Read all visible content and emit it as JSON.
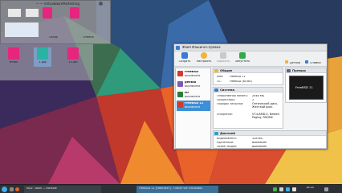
{
  "file_dialog": {
    "title": "~ — VirtualBoxVMs/testing",
    "buttons": [
      "Обзор",
      "Отмена"
    ],
    "files": [
      {
        "label": "fff.avi",
        "color": "#e6257e"
      },
      {
        "label": "1.jpg",
        "color": "#29b3a3"
      },
      {
        "label": "11.avi",
        "color": "#e6257e"
      }
    ]
  },
  "vbox": {
    "menu": [
      "Файл",
      "Машина",
      "Справка"
    ],
    "toolbar": [
      {
        "label": "Создать",
        "icon": "new-icon",
        "color": "#3b7ad6"
      },
      {
        "label": "Настроить",
        "icon": "settings-icon",
        "color": "#f0b43a"
      },
      {
        "label": "Сбросить",
        "icon": "discard-icon",
        "color": "#c9c9c9"
      },
      {
        "label": "Запустить",
        "icon": "start-icon",
        "color": "#33a94a"
      }
    ],
    "toolbar_right": [
      "Детали",
      "Снимки"
    ],
    "vm_list": [
      {
        "name": "FreeBSD",
        "state": "Выключена",
        "color": "#d33a2c"
      },
      {
        "name": "gentoo",
        "state": "Выключена",
        "color": "#7b5ab8"
      },
      {
        "name": "Mi",
        "state": "Выключена",
        "color": "#2f7a3a"
      },
      {
        "name": "FreeBSD 11",
        "state": "Выключена",
        "color": "#d33a2c",
        "selected": true
      }
    ],
    "general": {
      "title": "Общие",
      "rows": [
        {
          "k": "Имя:",
          "v": "FreeBSD 11"
        },
        {
          "k": "ОС:",
          "v": "FreeBSD (64 bit)"
        }
      ]
    },
    "preview": {
      "title": "Превью",
      "screen_text": "FreeBSD 11"
    },
    "system": {
      "title": "Система",
      "rows": [
        {
          "k": "Оперативная память:",
          "v": "2048 МБ"
        },
        {
          "k": "Процессоры:",
          "v": "2"
        },
        {
          "k": "Порядок загрузки:",
          "v": "Оптический диск, Жесткий диск"
        },
        {
          "k": "Ускорение:",
          "v": "VT-x/AMD-V, Nested Paging, PAE/NX"
        }
      ]
    },
    "display": {
      "title": "Дисплей",
      "rows": [
        {
          "k": "Видеопамять:",
          "v": "128 МБ"
        },
        {
          "k": "Удалённый:",
          "v": "Выключен"
        },
        {
          "k": "Захват видео:",
          "v": "Выключен"
        }
      ]
    }
  },
  "taskbar": {
    "items": [
      "mpv - bash — Konsole",
      "FreeBSD 11 [Работает] - Oracle VM VirtualBox"
    ],
    "clock": "18:20"
  }
}
